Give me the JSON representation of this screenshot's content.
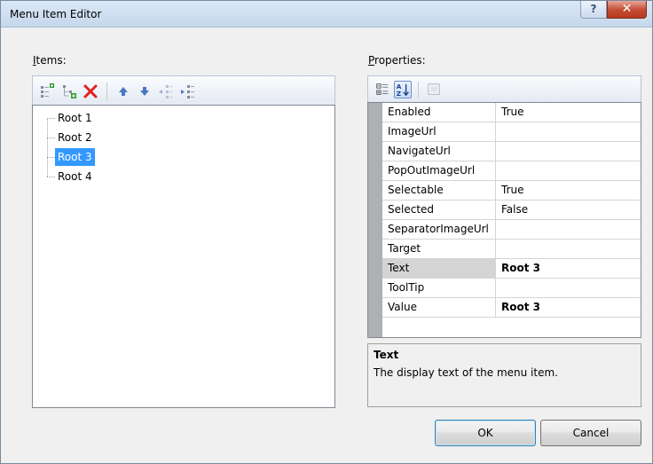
{
  "window": {
    "title": "Menu Item Editor",
    "help_glyph": "?",
    "close_glyph": "✕"
  },
  "items_pane": {
    "label_accel": "I",
    "label_rest": "tems:",
    "toolbar": [
      "add-root-item-icon",
      "add-child-item-icon",
      "delete-item-icon",
      "move-up-icon",
      "move-down-icon",
      "unindent-icon",
      "indent-icon"
    ],
    "nodes": [
      {
        "label": "Root 1",
        "selected": false
      },
      {
        "label": "Root 2",
        "selected": false
      },
      {
        "label": "Root 3",
        "selected": true
      },
      {
        "label": "Root 4",
        "selected": false
      }
    ]
  },
  "properties_pane": {
    "label_accel": "P",
    "label_rest": "roperties:",
    "toolbar": [
      "categorized-icon",
      "alphabetical-icon",
      "property-pages-icon"
    ],
    "rows": [
      {
        "name": "Enabled",
        "value": "True"
      },
      {
        "name": "ImageUrl",
        "value": ""
      },
      {
        "name": "NavigateUrl",
        "value": ""
      },
      {
        "name": "PopOutImageUrl",
        "value": ""
      },
      {
        "name": "Selectable",
        "value": "True"
      },
      {
        "name": "Selected",
        "value": "False"
      },
      {
        "name": "SeparatorImageUrl",
        "value": ""
      },
      {
        "name": "Target",
        "value": ""
      },
      {
        "name": "Text",
        "value": "Root 3",
        "selected": true,
        "bold": true
      },
      {
        "name": "ToolTip",
        "value": ""
      },
      {
        "name": "Value",
        "value": "Root 3",
        "bold": true
      }
    ],
    "description": {
      "title": "Text",
      "text": "The display text of the menu item."
    }
  },
  "buttons": {
    "ok": "OK",
    "cancel": "Cancel"
  },
  "colors": {
    "selection": "#3399ff",
    "grid_margin": "#aeb0b2",
    "delete_red": "#e02020"
  }
}
